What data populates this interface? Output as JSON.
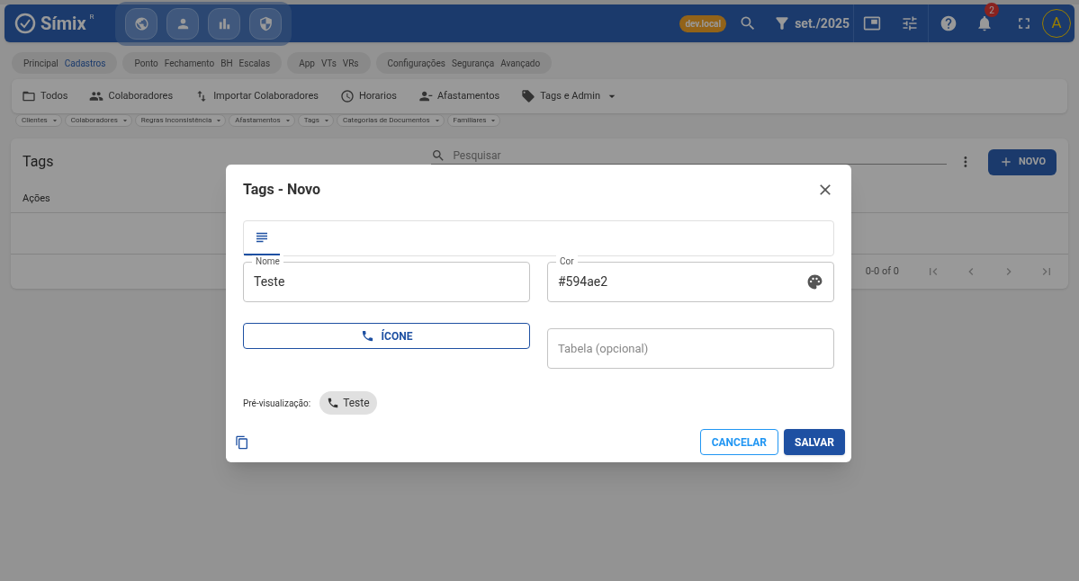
{
  "app_bar": {
    "logo": "Símix",
    "logo_mark": "R",
    "env_badge": "dev.local",
    "period": "set./2025",
    "notification_count": "2",
    "avatar": "A"
  },
  "nav_groups": [
    [
      {
        "label": "Principal",
        "selected": false
      },
      {
        "label": "Cadastros",
        "selected": true
      }
    ],
    [
      {
        "label": "Ponto",
        "selected": false
      },
      {
        "label": "Fechamento",
        "selected": false
      },
      {
        "label": "BH",
        "selected": false
      },
      {
        "label": "Escalas",
        "selected": false
      }
    ],
    [
      {
        "label": "App",
        "selected": false
      },
      {
        "label": "VTs",
        "selected": false
      },
      {
        "label": "VRs",
        "selected": false
      }
    ],
    [
      {
        "label": "Configurações",
        "selected": false
      },
      {
        "label": "Segurança",
        "selected": false
      },
      {
        "label": "Avançado",
        "selected": false
      }
    ]
  ],
  "toolbar": [
    {
      "label": "Todos",
      "has_menu": false
    },
    {
      "label": "Colaboradores",
      "has_menu": false
    },
    {
      "label": "Importar Colaboradores",
      "has_menu": false
    },
    {
      "label": "Horarios",
      "has_menu": false
    },
    {
      "label": "Afastamentos",
      "has_menu": false
    },
    {
      "label": "Tags e Admin",
      "has_menu": true
    }
  ],
  "filter_chips": [
    "Clientes",
    "Colaboradores",
    "Regras Inconsistência",
    "Afastamentos",
    "Tags",
    "Categorias de Documentos",
    "Familiares"
  ],
  "tags_card": {
    "title": "Tags",
    "search_placeholder": "Pesquisar",
    "new_button": "NOVO",
    "columns": [
      "Ações"
    ],
    "pagination": "0-0 of 0"
  },
  "dialog": {
    "title": "Tags - Novo",
    "tabs": [
      {
        "selected": true
      }
    ],
    "name_field": {
      "label": "Nome",
      "value": "Teste"
    },
    "color_field": {
      "label": "Cor",
      "value": "#594ae2"
    },
    "icon_button": "ÍCONE",
    "table_field": {
      "placeholder": "Tabela (opcional)"
    },
    "preview_label": "Pré-visualização:",
    "preview_chip": "Teste",
    "cancel_button": "CANCELAR",
    "save_button": "SALVAR"
  }
}
